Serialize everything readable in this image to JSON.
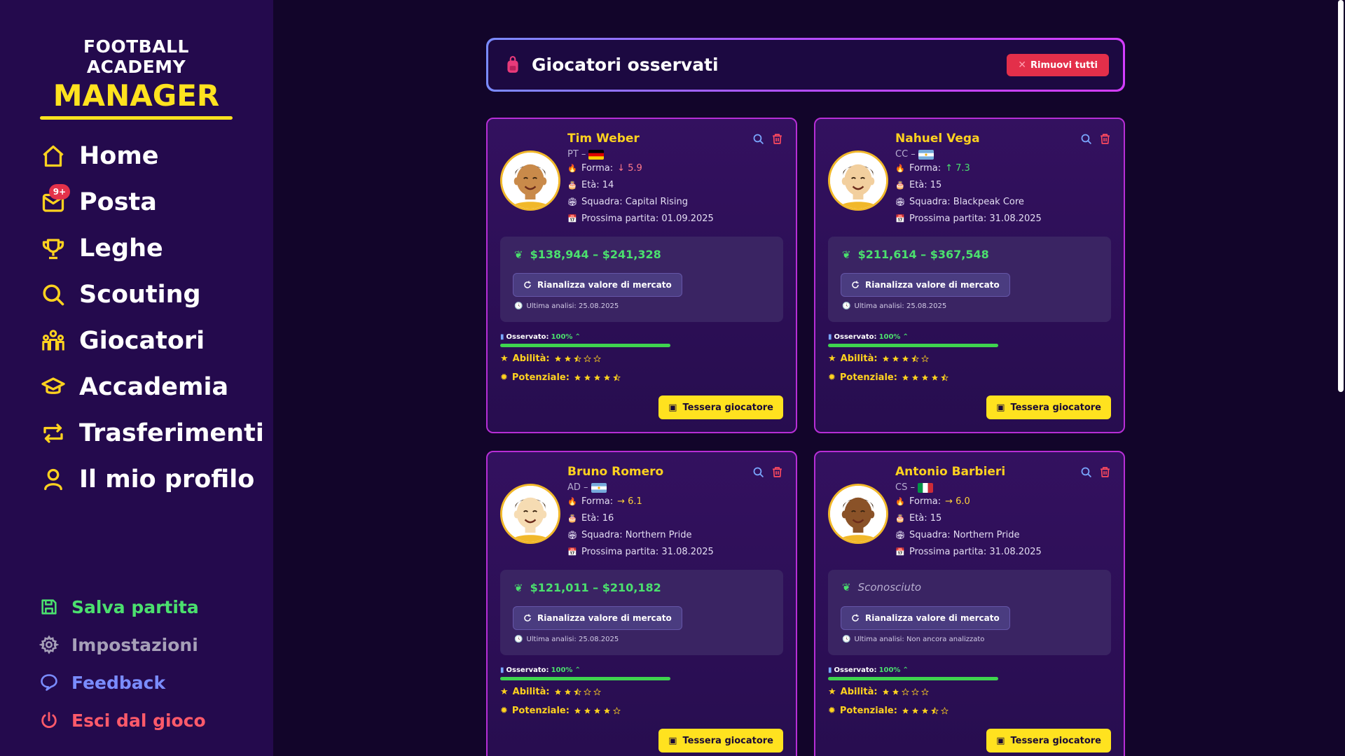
{
  "app": {
    "logo_top": "FOOTBALL ACADEMY",
    "logo_main": "MANAGER"
  },
  "sidebar": {
    "items": [
      {
        "label": "Home",
        "icon": "home-icon"
      },
      {
        "label": "Posta",
        "icon": "mail-icon",
        "badge": "9+"
      },
      {
        "label": "Leghe",
        "icon": "trophy-icon"
      },
      {
        "label": "Scouting",
        "icon": "search-icon"
      },
      {
        "label": "Giocatori",
        "icon": "players-icon"
      },
      {
        "label": "Accademia",
        "icon": "graduation-cap-icon"
      },
      {
        "label": "Trasferimenti",
        "icon": "transfer-icon"
      },
      {
        "label": "Il mio profilo",
        "icon": "user-icon"
      }
    ],
    "bottom_items": [
      {
        "label": "Salva partita",
        "icon": "save-icon",
        "color": "#4be06e"
      },
      {
        "label": "Impostazioni",
        "icon": "gear-icon",
        "color": "#a6a0b8"
      },
      {
        "label": "Feedback",
        "icon": "chat-icon",
        "color": "#7a8cff"
      },
      {
        "label": "Esci dal gioco",
        "icon": "power-icon",
        "color": "#ff5a6a"
      }
    ]
  },
  "header": {
    "title": "Giocatori osservati",
    "remove_all": "Rimuovi tutti"
  },
  "labels": {
    "form": "Forma:",
    "age": "Età:",
    "team": "Squadra:",
    "next_match": "Prossima partita:",
    "reanalyze": "Rianalizza valore di mercato",
    "last_analysis": "Ultima analisi:",
    "observed": "Osservato:",
    "ability": "Abilità:",
    "potential": "Potenziale:",
    "card_button": "Tessera giocatore"
  },
  "cards": [
    {
      "name": "Tim Weber",
      "position": "PT –",
      "flag": "germany",
      "form": "5.9",
      "form_trend": "down",
      "age": "14",
      "team": "Capital Rising",
      "next_match": "01.09.2025",
      "value": "$138,944 – $241,328",
      "value_known": true,
      "last_analysis": "25.08.2025",
      "observed": "100%",
      "ability_stars": 2.5,
      "potential_stars": 4.5,
      "skin": "#c98a4a"
    },
    {
      "name": "Nahuel Vega",
      "position": "CC –",
      "flag": "argentina",
      "form": "7.3",
      "form_trend": "up",
      "age": "15",
      "team": "Blackpeak Core",
      "next_match": "31.08.2025",
      "value": "$211,614 – $367,548",
      "value_known": true,
      "last_analysis": "25.08.2025",
      "observed": "100%",
      "ability_stars": 3.5,
      "potential_stars": 4.5,
      "skin": "#f2cf9e"
    },
    {
      "name": "Bruno Romero",
      "position": "AD –",
      "flag": "argentina",
      "form": "6.1",
      "form_trend": "flat",
      "age": "16",
      "team": "Northern Pride",
      "next_match": "31.08.2025",
      "value": "$121,011 – $210,182",
      "value_known": true,
      "last_analysis": "25.08.2025",
      "observed": "100%",
      "ability_stars": 2.5,
      "potential_stars": 4,
      "skin": "#f6dcb3"
    },
    {
      "name": "Antonio Barbieri",
      "position": "CS –",
      "flag": "italy",
      "form": "6.0",
      "form_trend": "flat",
      "age": "15",
      "team": "Northern Pride",
      "next_match": "31.08.2025",
      "value": "Sconosciuto",
      "value_known": false,
      "last_analysis": "Non ancora analizzato",
      "observed": "100%",
      "ability_stars": 2,
      "potential_stars": 3.5,
      "skin": "#8a5228"
    }
  ]
}
